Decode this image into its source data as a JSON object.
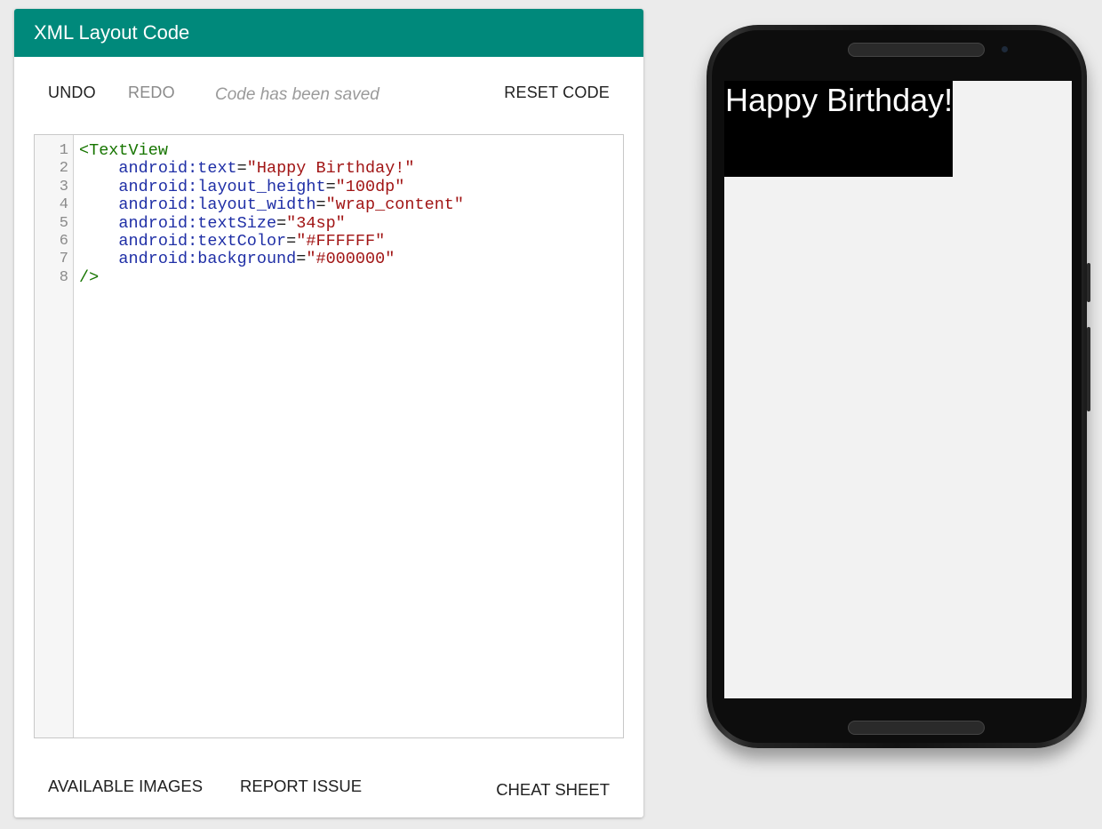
{
  "editor": {
    "title": "XML Layout Code",
    "toolbar": {
      "undo": "UNDO",
      "redo": "REDO",
      "status": "Code has been saved",
      "reset": "RESET CODE"
    },
    "code_lines": [
      {
        "num": "1",
        "tag": "<TextView",
        "indent": "",
        "attr": "",
        "value": ""
      },
      {
        "num": "2",
        "indent": "    ",
        "attr": "android:text",
        "value": "\"Happy Birthday!\""
      },
      {
        "num": "3",
        "indent": "    ",
        "attr": "android:layout_height",
        "value": "\"100dp\""
      },
      {
        "num": "4",
        "indent": "    ",
        "attr": "android:layout_width",
        "value": "\"wrap_content\""
      },
      {
        "num": "5",
        "indent": "    ",
        "attr": "android:textSize",
        "value": "\"34sp\""
      },
      {
        "num": "6",
        "indent": "    ",
        "attr": "android:textColor",
        "value": "\"#FFFFFF\""
      },
      {
        "num": "7",
        "indent": "    ",
        "attr": "android:background",
        "value": "\"#000000\""
      },
      {
        "num": "8",
        "tag": "/>",
        "indent": "",
        "attr": "",
        "value": ""
      }
    ],
    "footer": {
      "available_images": "AVAILABLE IMAGES",
      "report_issue": "REPORT ISSUE",
      "cheat_sheet": "CHEAT SHEET"
    }
  },
  "preview": {
    "textview_text": "Happy Birthday!",
    "textview_text_color": "#FFFFFF",
    "textview_background": "#000000"
  },
  "colors": {
    "header": "#00897b",
    "page_background": "#ebebeb"
  }
}
